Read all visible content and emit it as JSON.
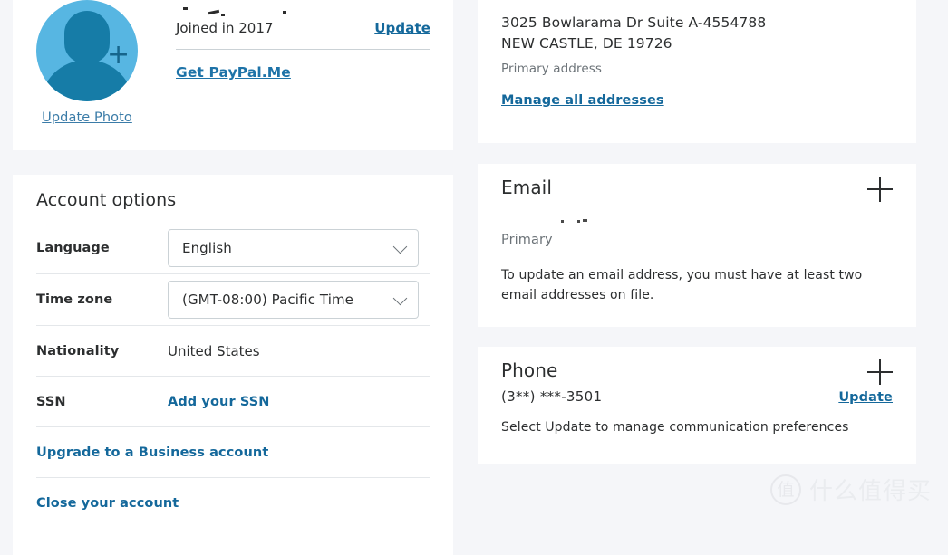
{
  "profile": {
    "avatar_alt": "user-avatar",
    "update_photo_label": "Update Photo",
    "name_redacted": "",
    "joined_text": "Joined in 2017",
    "update_label": "Update",
    "paypalme_label": "Get PayPal.Me"
  },
  "account_options": {
    "title": "Account options",
    "language": {
      "label": "Language",
      "value": "English"
    },
    "timezone": {
      "label": "Time zone",
      "value": "(GMT-08:00) Pacific Time"
    },
    "nationality": {
      "label": "Nationality",
      "value": "United States"
    },
    "ssn": {
      "label": "SSN",
      "action_label": "Add your SSN"
    },
    "upgrade_label": "Upgrade to a Business account",
    "close_label": "Close your account"
  },
  "address": {
    "line1": "3025 Bowlarama Dr Suite A-4554788",
    "line2": "NEW CASTLE, DE 19726",
    "subtitle": "Primary address",
    "manage_label": "Manage all addresses"
  },
  "email": {
    "title": "Email",
    "add_label": "+",
    "address_redacted": "",
    "primary_label": "Primary",
    "note": "To update an email address, you must have at least two email addresses on file."
  },
  "phone": {
    "title": "Phone",
    "add_label": "+",
    "number": "(3**) ***-3501",
    "update_label": "Update",
    "note": "Select Update to manage communication preferences"
  },
  "watermark": {
    "badge": "值",
    "text": "什么值得买"
  },
  "colors": {
    "link_blue": "#14689b",
    "accent_blue": "#1e73a8",
    "avatar_light": "#57b6e2",
    "avatar_dark": "#167ca7",
    "page_bg": "#f5f6f9",
    "card_bg": "#ffffff"
  }
}
